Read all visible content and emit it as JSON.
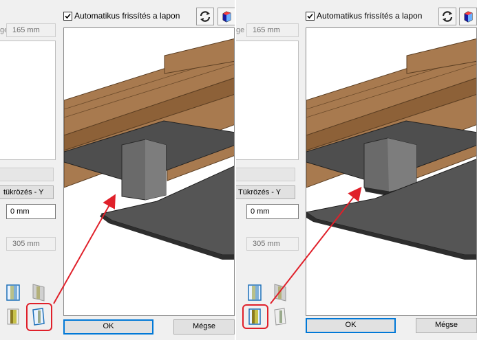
{
  "dialog": {
    "auto_refresh_label": "Automatikus frissítés a lapon",
    "auto_refresh_checked": true,
    "ok_label": "OK",
    "cancel_label": "Mégse",
    "size_top": "165 mm",
    "size_top_label_fragment": "ge",
    "mirror_y_label": "ükrözés - Y",
    "offset_value": "0 mm",
    "size_bottom": "305 mm"
  },
  "panel_before": {
    "mirror_y_label": "tükrözés - Y"
  },
  "panel_after": {
    "mirror_y_label": "Tükrözés - Y"
  },
  "icons": {
    "refresh": "refresh-icon",
    "view3d": "cube-3d-icon",
    "placement_options": [
      "placement-front-icon",
      "placement-back-icon",
      "placement-left-icon",
      "placement-right-icon"
    ]
  },
  "colors": {
    "highlight": "#e0202a",
    "accent": "#0078d7",
    "wood": "#a87a4f",
    "metal": "#4e4e4e"
  }
}
